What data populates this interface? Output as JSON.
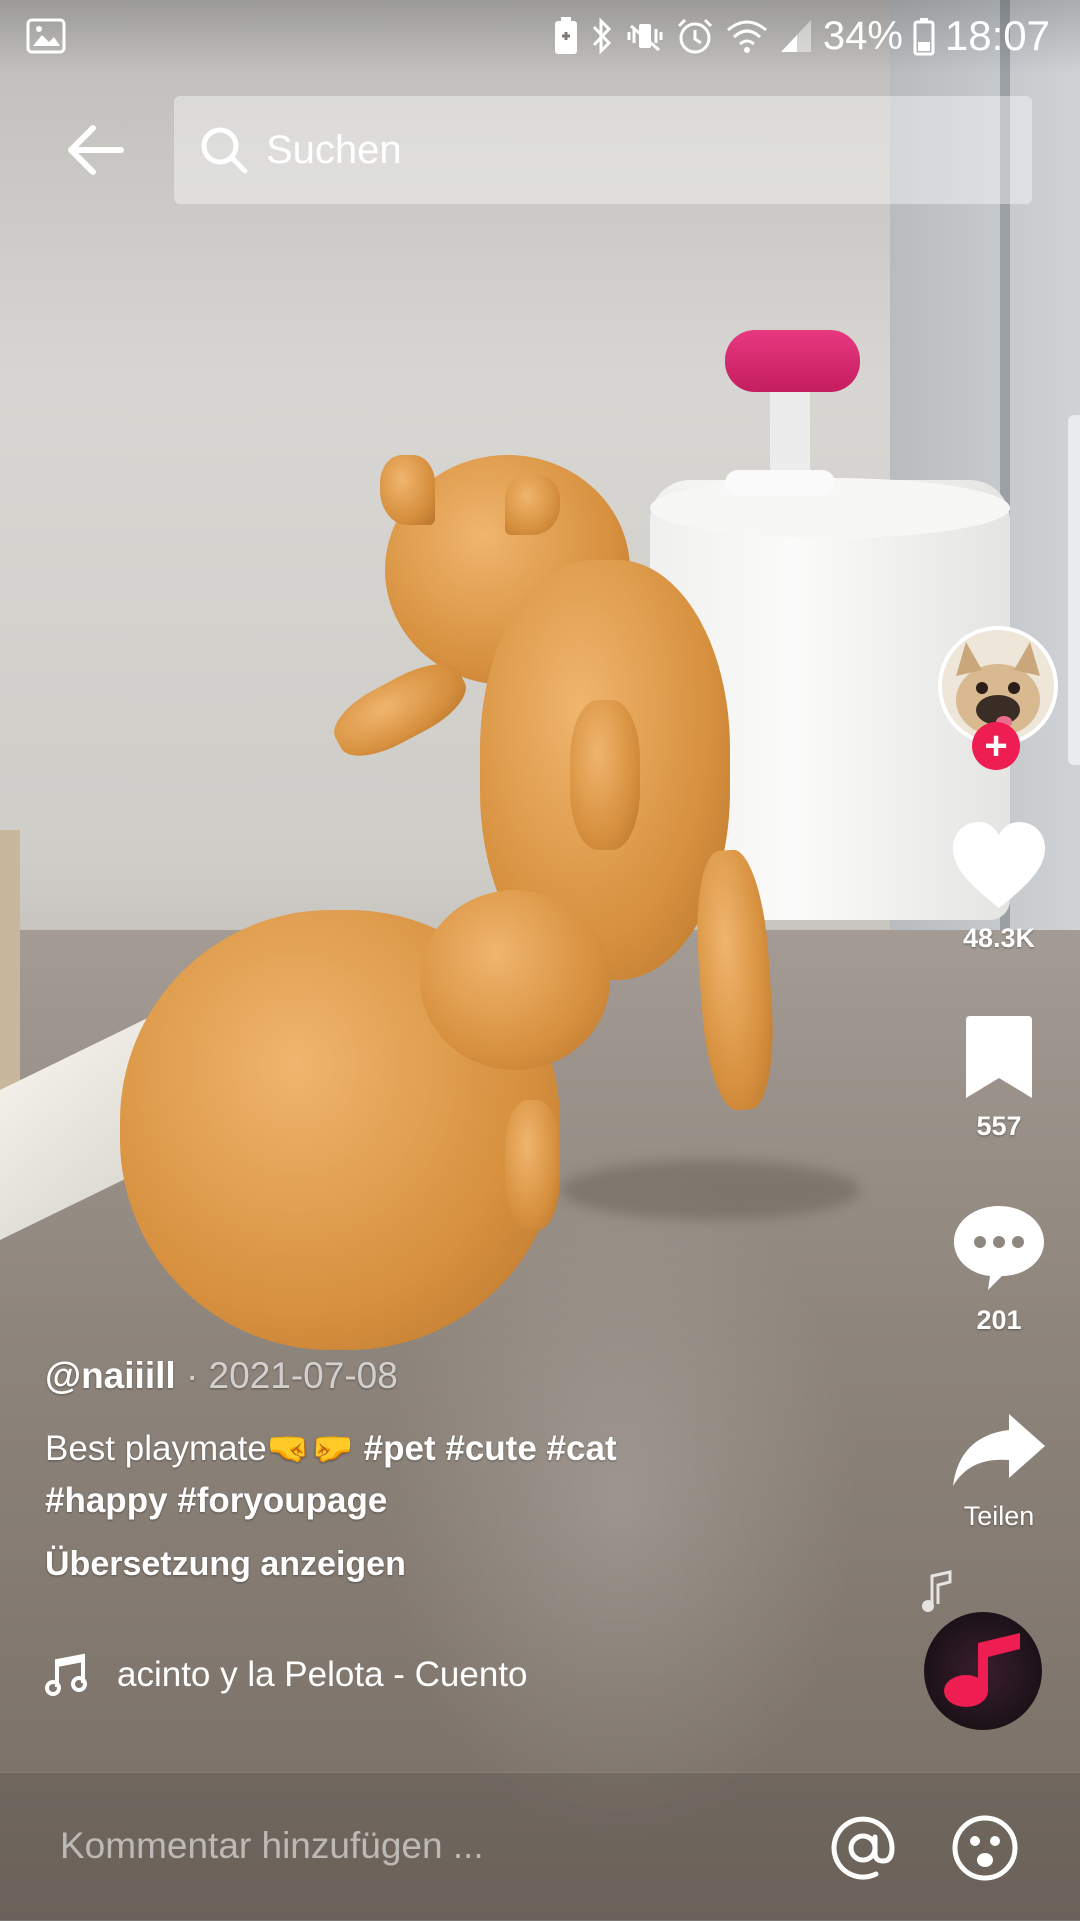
{
  "status_bar": {
    "battery_percent": "34%",
    "time": "18:07",
    "icons": [
      "image-notification-icon",
      "battery-saver-icon",
      "bluetooth-icon",
      "vibrate-icon",
      "alarm-icon",
      "wifi-icon",
      "signal-icon",
      "battery-icon"
    ]
  },
  "header": {
    "back_icon": "arrow-left-icon",
    "search_placeholder": "Suchen"
  },
  "video": {
    "author": "@naiiill",
    "separator": "·",
    "date": "2021-07-08",
    "description_text": "Best playmate🤜🤛",
    "hashtags": [
      "#pet",
      "#cute",
      "#cat",
      "#happy",
      "#foryoupage"
    ],
    "translate_label": "Übersetzung anzeigen",
    "sound_name": "acinto y la Pelota - Cuento"
  },
  "actions": {
    "like_count": "48.3K",
    "save_count": "557",
    "comment_count": "201",
    "share_label": "Teilen",
    "follow_symbol": "+"
  },
  "comment_bar": {
    "placeholder": "Kommentar hinzufügen ...",
    "mention_icon": "at-sign-icon",
    "emoji_icon": "emoji-icon"
  },
  "colors": {
    "accent": "#ee1d52",
    "music_disc_note": "#ee1d52"
  }
}
